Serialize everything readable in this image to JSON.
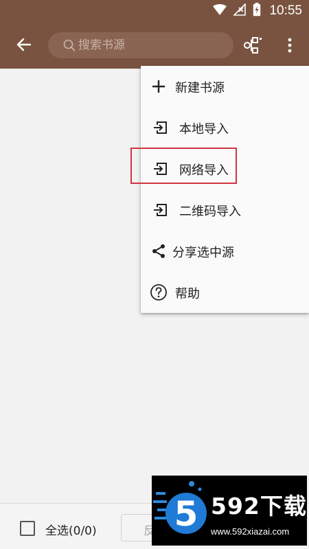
{
  "status_bar": {
    "time": "10:55",
    "icons": [
      "wifi-icon",
      "signal-off-icon",
      "battery-charging-icon"
    ]
  },
  "toolbar": {
    "back_icon": "arrow-left-icon",
    "search_placeholder": "搜索书源",
    "group_icon": "group-icon",
    "more_icon": "more-vertical-icon"
  },
  "popup_menu": {
    "items": [
      {
        "label": "新建书源",
        "icon": "plus-icon"
      },
      {
        "label": "本地导入",
        "icon": "import-icon"
      },
      {
        "label": "网络导入",
        "icon": "import-icon",
        "highlighted": true
      },
      {
        "label": "二维码导入",
        "icon": "import-icon"
      },
      {
        "label": "分享选中源",
        "icon": "share-icon"
      },
      {
        "label": "帮助",
        "icon": "help-icon"
      }
    ]
  },
  "bottom_bar": {
    "select_all_label": "全选(0/0)",
    "invert_label": "反"
  },
  "watermark": {
    "brand": "592下载",
    "url": "www.592xiazai.com"
  },
  "colors": {
    "toolbar": "#7a5340",
    "search_box": "#8a6452",
    "highlight": "#d0343e",
    "menu_bg": "#fafafa"
  }
}
